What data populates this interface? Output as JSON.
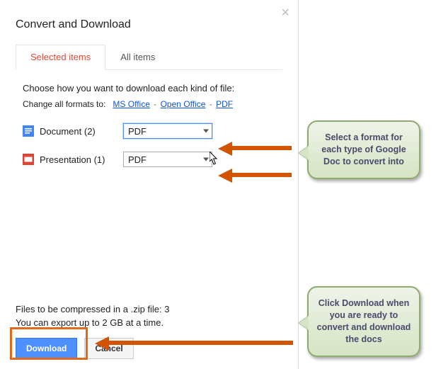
{
  "dialog": {
    "title": "Convert and Download",
    "close_icon": "×",
    "tabs": {
      "selected": "Selected items",
      "all": "All items"
    },
    "instruction": "Choose how you want to download each kind of file:",
    "change_prefix": "Change all formats to:",
    "quick_formats": {
      "ms_office": "MS Office",
      "open_office": "Open Office",
      "pdf": "PDF"
    },
    "filetypes": [
      {
        "label": "Document (2)",
        "value": "PDF",
        "icon": "doc"
      },
      {
        "label": "Presentation (1)",
        "value": "PDF",
        "icon": "slides"
      }
    ],
    "footer": {
      "compress_line": "Files to be compressed in a .zip file: 3",
      "export_line": "You can export up to 2 GB at a time.",
      "download_label": "Download",
      "cancel_label": "Cancel"
    }
  },
  "callouts": {
    "top": "Select a format for each type of Google Doc to convert into",
    "bottom": "Click Download when you are ready to convert and download the docs"
  }
}
